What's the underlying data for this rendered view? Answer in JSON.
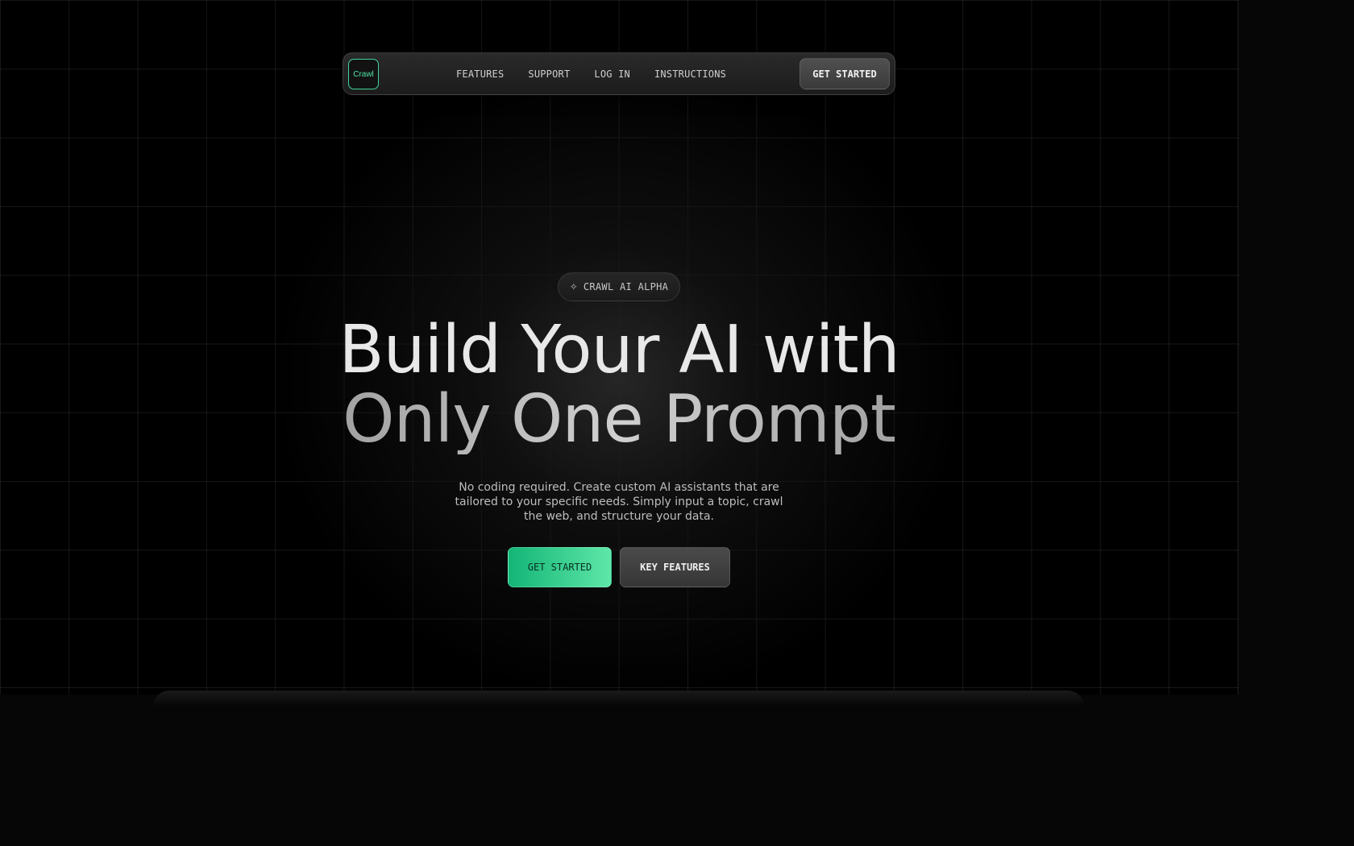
{
  "nav": {
    "logo": "Crawl",
    "links": [
      "FEATURES",
      "SUPPORT",
      "LOG IN",
      "INSTRUCTIONS"
    ],
    "cta_label": "GET STARTED"
  },
  "hero": {
    "badge_icon": "sparkle-icon",
    "badge_label": "CRAWL AI ALPHA",
    "headline_line1": "Build Your AI with",
    "headline_line2": "Only One Prompt",
    "description": "No coding required. Create custom AI assistants that are tailored to your specific needs. Simply input a topic, crawl the web, and structure your data.",
    "primary_button": "GET STARTED",
    "secondary_button": "KEY FEATURES"
  },
  "colors": {
    "accent_green": "#13b577",
    "accent_green_light": "#5ee7a8",
    "background": "#000000"
  }
}
